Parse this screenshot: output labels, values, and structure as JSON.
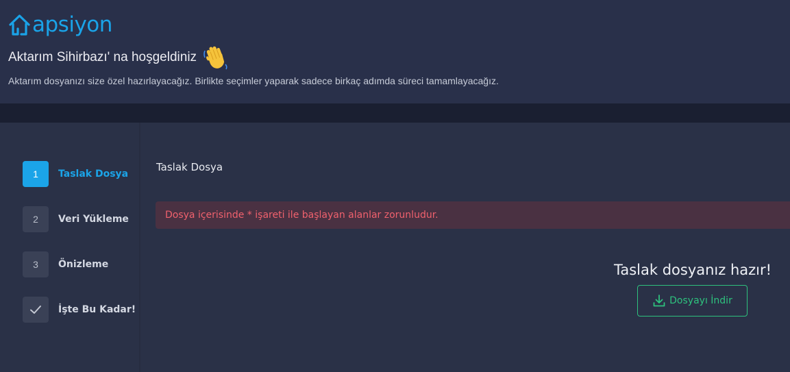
{
  "brand": {
    "logo_text": "apsiyon",
    "logo_color": "#1aa3e8"
  },
  "welcome": {
    "title": "Aktarım Sihirbazı' na hoşgeldiniz",
    "emoji": "waving-hand",
    "subtitle": "Aktarım dosyanızı size özel hazırlayacağız. Birlikte seçimler yaparak sadece birkaç adımda süreci tamamlayacağız."
  },
  "steps": [
    {
      "number": "1",
      "label": "Taslak Dosya",
      "active": true
    },
    {
      "number": "2",
      "label": "Veri Yükleme",
      "active": false
    },
    {
      "number": "3",
      "label": "Önizleme",
      "active": false
    },
    {
      "number": "",
      "label": "İşte Bu Kadar!",
      "icon": "check-icon",
      "active": false
    }
  ],
  "panel": {
    "title": "Taslak Dosya",
    "alert": "Dosya içerisinde * işareti ile başlayan alanlar zorunludur.",
    "ready_text": "Taslak dosyanız hazır!",
    "download_label": "Dosyayı İndir"
  },
  "colors": {
    "accent": "#1ba4e8",
    "success": "#2ec27e",
    "danger": "#f0616d",
    "background": "#2a3147"
  }
}
